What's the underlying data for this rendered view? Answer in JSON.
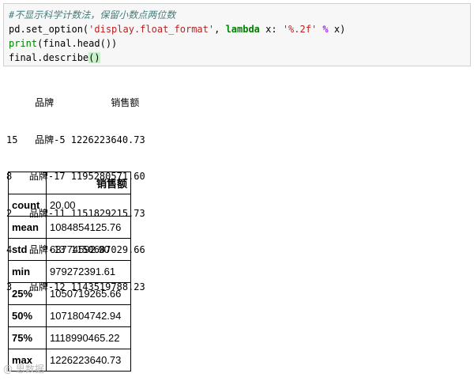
{
  "code": {
    "comment": "#不显示科学计数法，保留小数点两位数",
    "line2_a": "pd.set_option(",
    "line2_str1": "'display.float_format'",
    "line2_b": ", ",
    "line2_kw": "lambda",
    "line2_c": " x: ",
    "line2_str2": "'%.2f'",
    "line2_d": " ",
    "line2_op": "%",
    "line2_e": " x)",
    "line3_fn": "print",
    "line3_rest": "(final.head())",
    "line4_a": "final.describe",
    "line4_paren": "()"
  },
  "print_output": {
    "header": "     品牌          销售额",
    "rows": [
      "15   品牌-5 1226223640.73",
      "8   品牌-17 1195280571.60",
      "2   品牌-11 1151829215.73",
      "4   品牌-13 1150687029.66",
      "3   品牌-12 1143519788.23"
    ]
  },
  "describe_table": {
    "column": "销售额",
    "rows": [
      {
        "stat": "count",
        "value": "20.00"
      },
      {
        "stat": "mean",
        "value": "1084854125.76"
      },
      {
        "stat": "std",
        "value": "63774592.90"
      },
      {
        "stat": "min",
        "value": "979272391.61"
      },
      {
        "stat": "25%",
        "value": "1050719265.66"
      },
      {
        "stat": "50%",
        "value": "1071804742.94"
      },
      {
        "stat": "75%",
        "value": "1118990465.22"
      },
      {
        "stat": "max",
        "value": "1226223640.73"
      }
    ]
  },
  "watermark": "@ 思数据"
}
